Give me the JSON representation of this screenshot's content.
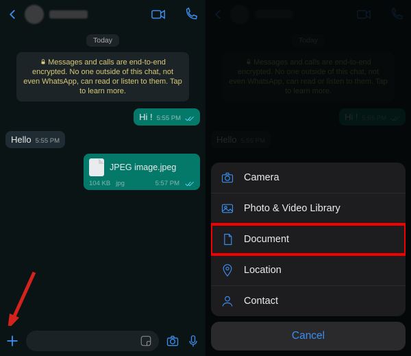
{
  "left": {
    "dayLabel": "Today",
    "systemNotice": "Messages and calls are end-to-end encrypted. No one outside of this chat, not even WhatsApp, can read or listen to them. Tap to learn more.",
    "msgOut1": {
      "text": "Hi !",
      "time": "5:55 PM"
    },
    "msgIn1": {
      "text": "Hello",
      "time": "5:55 PM"
    },
    "file": {
      "name": "JPEG image.jpeg",
      "size": "104 KB",
      "ext": "jpg",
      "time": "5:57 PM"
    }
  },
  "right": {
    "dayLabel": "Today",
    "systemNotice": "Messages and calls are end-to-end encrypted. No one outside of this chat, not even WhatsApp, can read or listen to them. Tap to learn more.",
    "msgOut1": {
      "text": "Hi !",
      "time": "5:55 PM"
    },
    "msgIn1": {
      "text": "Hello",
      "time": "5:55 PM"
    },
    "sheet": {
      "camera": "Camera",
      "photo": "Photo & Video Library",
      "document": "Document",
      "location": "Location",
      "contact": "Contact",
      "cancel": "Cancel"
    }
  }
}
